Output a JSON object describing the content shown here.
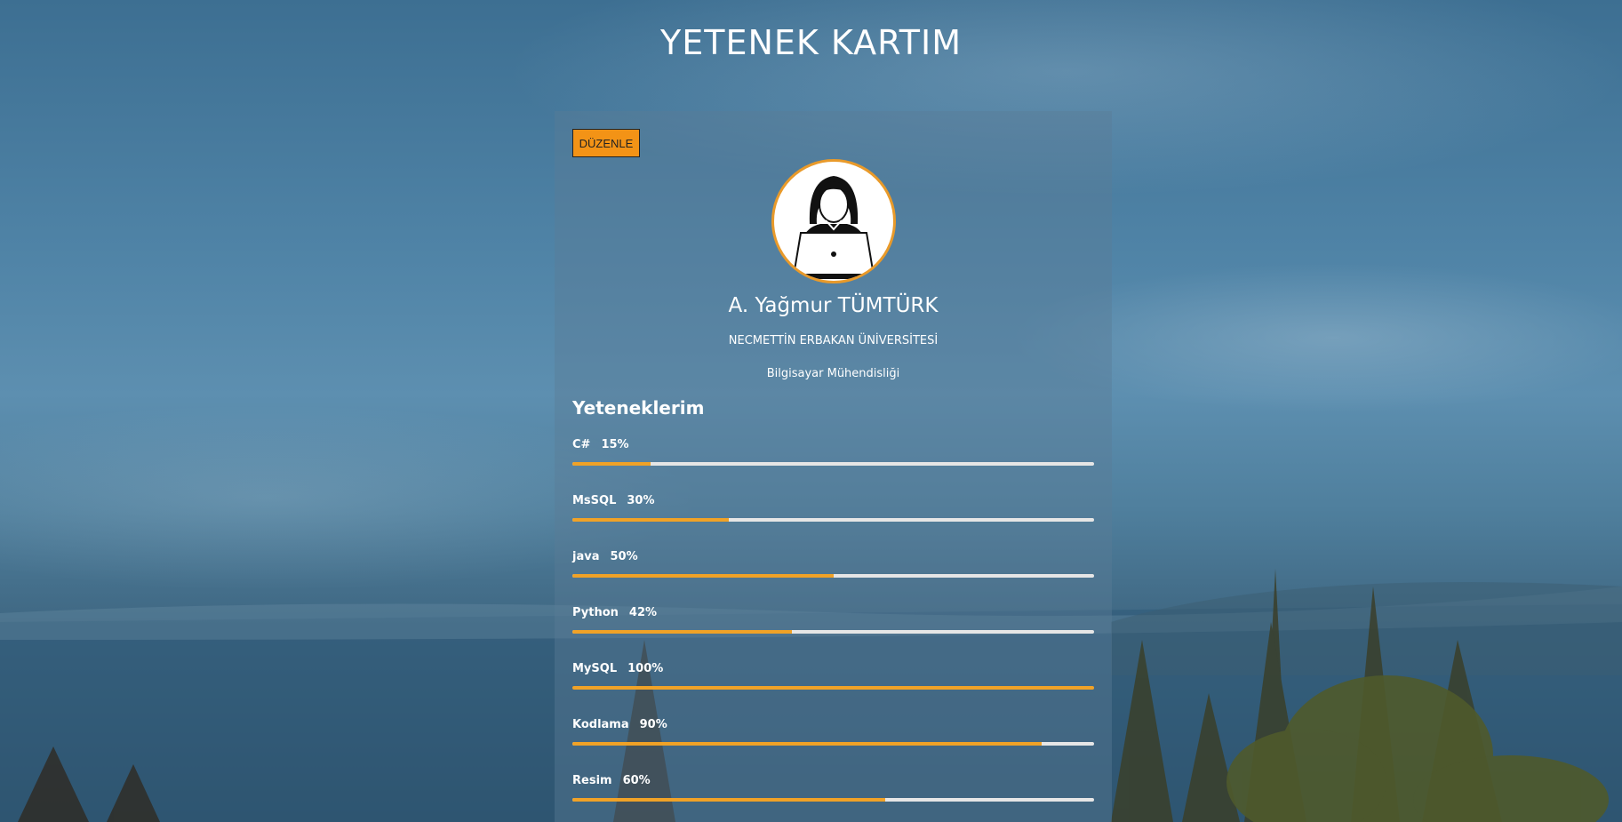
{
  "page": {
    "title": "YETENEK KARTIM"
  },
  "card": {
    "edit_label": "DÜZENLE",
    "name": "A. Yağmur TÜMTÜRK",
    "school": "NECMETTİN ERBAKAN ÜNİVERSİTESİ",
    "department": "Bilgisayar Mühendisliği",
    "skills_heading": "Yeteneklerim",
    "avatar_icon": "user-with-laptop-icon"
  },
  "skills": [
    {
      "name": "C#",
      "percent_label": "15%",
      "percent": 15
    },
    {
      "name": "MsSQL",
      "percent_label": "30%",
      "percent": 30
    },
    {
      "name": "java",
      "percent_label": "50%",
      "percent": 50
    },
    {
      "name": "Python",
      "percent_label": "42%",
      "percent": 42
    },
    {
      "name": "MySQL",
      "percent_label": "100%",
      "percent": 100
    },
    {
      "name": "Kodlama",
      "percent_label": "90%",
      "percent": 90
    },
    {
      "name": "Resim",
      "percent_label": "60%",
      "percent": 60
    }
  ],
  "colors": {
    "accent": "#f0a227",
    "button": "#f39316",
    "track": "#e6e6e6"
  }
}
